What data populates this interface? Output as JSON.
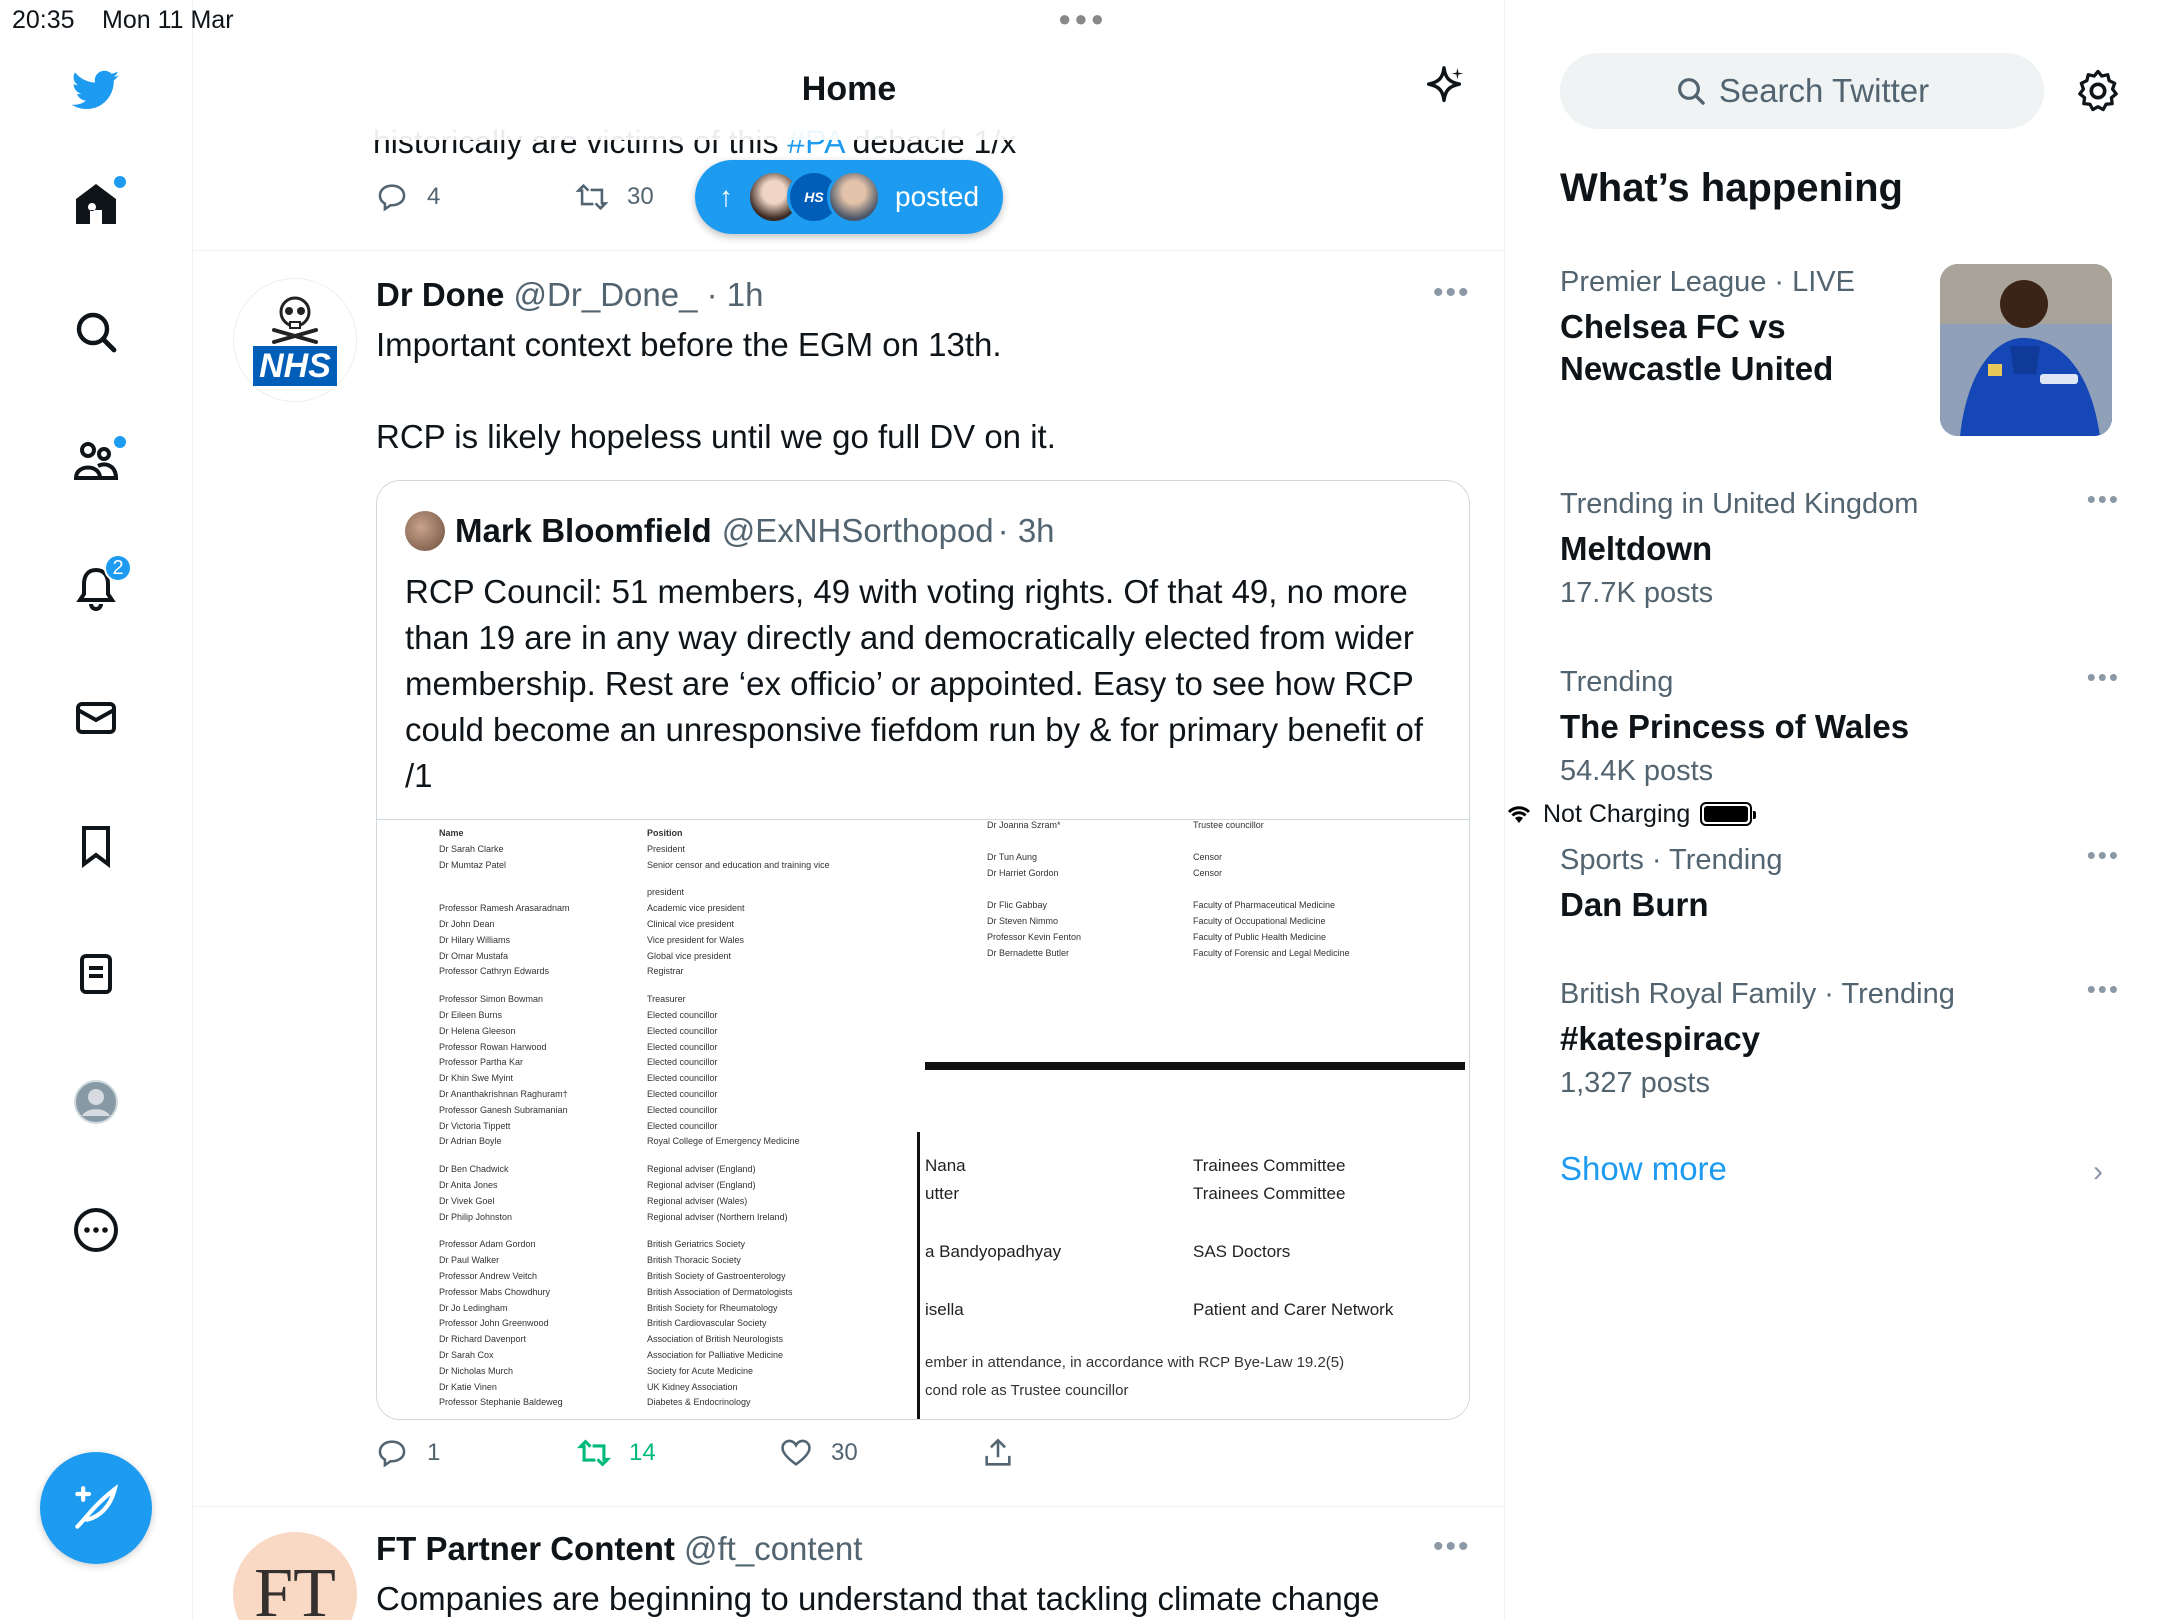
{
  "status": {
    "time": "20:35",
    "date": "Mon 11 Mar",
    "charging": "Not Charging"
  },
  "nav": {
    "notifications_badge": "2"
  },
  "header": {
    "title": "Home"
  },
  "prev_tweet": {
    "text_start": "historically are victims of this ",
    "hashtag": "#PA",
    "text_end": " debacle 1/x",
    "replies": "4",
    "retweets": "30"
  },
  "posted_pill": {
    "label": "posted"
  },
  "tweet": {
    "name": "Dr Done",
    "handle": "@Dr_Done_",
    "time": "· 1h",
    "avatar_text": "NHS",
    "text": "Important context before the EGM on 13th.\n\nRCP is likely hopeless until we go full DV on it.",
    "replies": "1",
    "retweets": "14",
    "likes": "30"
  },
  "quote": {
    "name": "Mark Bloomfield",
    "handle": "@ExNHSorthopod",
    "time": "· 3h",
    "text": "RCP Council: 51 members, 49 with voting rights. Of that 49, no more than 19 are in any way directly and democratically elected from wider membership. Rest are ‘ex officio’ or appointed. Easy to see how RCP could become an unresponsive fiefdom run by & for primary benefit of /1",
    "doc_left": [
      [
        "Name",
        "Position"
      ],
      [
        "Dr Sarah Clarke",
        "President"
      ],
      [
        "Dr Mumtaz Patel",
        "Senior censor and education and training vice"
      ],
      [
        "",
        "president"
      ],
      [
        "Professor Ramesh Arasaradnam",
        "Academic vice president"
      ],
      [
        "Dr John Dean",
        "Clinical vice president"
      ],
      [
        "Dr Hilary Williams",
        "Vice president for Wales"
      ],
      [
        "Dr Omar Mustafa",
        "Global vice president"
      ],
      [
        "Professor Cathryn Edwards",
        "Registrar"
      ],
      [
        "Professor Simon Bowman",
        "Treasurer"
      ],
      [
        "Dr Eileen Burns",
        "Elected councillor"
      ],
      [
        "Dr Helena Gleeson",
        "Elected councillor"
      ],
      [
        "Professor Rowan Harwood",
        "Elected councillor"
      ],
      [
        "Professor Partha Kar",
        "Elected councillor"
      ],
      [
        "Dr Khin Swe Myint",
        "Elected councillor"
      ],
      [
        "Dr Ananthakrishnan Raghuram†",
        "Elected councillor"
      ],
      [
        "Professor Ganesh Subramanian",
        "Elected councillor"
      ],
      [
        "Dr Victoria Tippett",
        "Elected councillor"
      ],
      [
        "Dr Adrian Boyle",
        "Royal College of Emergency Medicine"
      ],
      [
        "Dr Ben Chadwick",
        "Regional adviser (England)"
      ],
      [
        "Dr Anita Jones",
        "Regional adviser (England)"
      ],
      [
        "Dr Vivek Goel",
        "Regional adviser (Wales)"
      ],
      [
        "Dr Philip Johnston",
        "Regional adviser (Northern Ireland)"
      ],
      [
        "Professor Adam Gordon",
        "British Geriatrics Society"
      ],
      [
        "Dr Paul Walker",
        "British Thoracic Society"
      ],
      [
        "Professor Andrew Veitch",
        "British Society of Gastroenterology"
      ],
      [
        "Professor Mabs Chowdhury",
        "British Association of Dermatologists"
      ],
      [
        "Dr Jo Ledingham",
        "British Society for Rheumatology"
      ],
      [
        "Professor John Greenwood",
        "British Cardiovascular Society"
      ],
      [
        "Dr Richard Davenport",
        "Association of British Neurologists"
      ],
      [
        "Dr Sarah Cox",
        "Association for Palliative Medicine"
      ],
      [
        "Dr Nicholas Murch",
        "Society for Acute Medicine"
      ],
      [
        "Dr Katie Vinen",
        "UK Kidney Association"
      ],
      [
        "Professor Stephanie Baldeweg",
        "Diabetes & Endocrinology"
      ]
    ],
    "doc_right_top": [
      [
        "Dr Joanna Szram*",
        "Trustee councillor"
      ],
      [
        "Dr Tun Aung",
        "Censor"
      ],
      [
        "Dr Harriet Gordon",
        "Censor"
      ],
      [
        "Dr Flic Gabbay",
        "Faculty of Pharmaceutical Medicine"
      ],
      [
        "Dr Steven Nimmo",
        "Faculty of Occupational Medicine"
      ],
      [
        "Professor Kevin Fenton",
        "Faculty of Public Health Medicine"
      ],
      [
        "Dr Bernadette Butler",
        "Faculty of Forensic and Legal Medicine"
      ]
    ],
    "doc_right_bottom": [
      [
        "Nana",
        "Trainees Committee"
      ],
      [
        "utter",
        "Trainees Committee"
      ],
      [
        "a Bandyopadhyay",
        "SAS Doctors"
      ],
      [
        "isella",
        "Patient and Carer Network"
      ]
    ],
    "doc_footnote_1": "ember in attendance, in accordance with RCP Bye-Law 19.2(5)",
    "doc_footnote_2": "cond role as Trustee councillor"
  },
  "next_tweet": {
    "name": "FT Partner Content",
    "handle": "@ft_content",
    "avatar_text": "FT",
    "text": "Companies are beginning to understand that tackling climate change"
  },
  "right": {
    "search_placeholder": "Search Twitter",
    "heading": "What’s happening",
    "trends": [
      {
        "meta": "Premier League · LIVE",
        "topic": "Chelsea FC vs Newcastle United",
        "count": ""
      },
      {
        "meta": "Trending in United Kingdom",
        "topic": "Meltdown",
        "count": "17.7K posts"
      },
      {
        "meta": "Trending",
        "topic": "The Princess of Wales",
        "count": "54.4K posts"
      },
      {
        "meta": "Sports · Trending",
        "topic": "Dan Burn",
        "count": ""
      },
      {
        "meta": "British Royal Family · Trending",
        "topic": "#katespiracy",
        "count": "1,327 posts"
      }
    ],
    "show_more": "Show more"
  },
  "colors": {
    "accent": "#1d9bf0",
    "retweet_active": "#00ba7c",
    "text_secondary": "#536471"
  }
}
